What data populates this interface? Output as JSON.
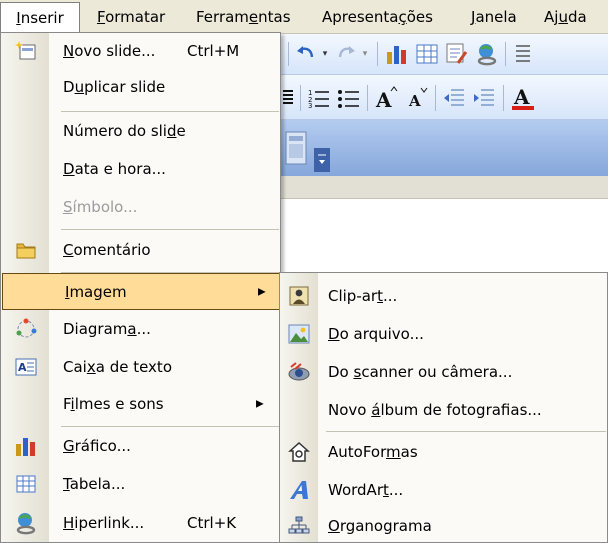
{
  "menubar": {
    "items": [
      {
        "label": "Inserir",
        "mnemonic_index": 0,
        "active": true
      },
      {
        "label": "Formatar",
        "mnemonic_index": 0
      },
      {
        "label": "Ferramentas",
        "mnemonic_index": 6
      },
      {
        "label": "Apresentações",
        "mnemonic_index": 9
      },
      {
        "label": "Janela",
        "mnemonic_index": 0
      },
      {
        "label": "Ajuda",
        "mnemonic_index": 2
      }
    ]
  },
  "insert_menu": {
    "items": [
      {
        "label": "Novo slide...",
        "mnemonic_index": 0,
        "shortcut": "Ctrl+M",
        "icon": "new-slide-icon"
      },
      {
        "label": "Duplicar slide",
        "mnemonic_index": 1
      },
      {
        "label": "Número do slide",
        "mnemonic_index": 13
      },
      {
        "label": "Data e hora...",
        "mnemonic_index": 0
      },
      {
        "label": "Símbolo...",
        "mnemonic_index": 0,
        "disabled": true
      },
      {
        "label": "Comentário",
        "mnemonic_index": 0,
        "icon": "comment-icon"
      },
      {
        "label": "Imagem",
        "mnemonic_index": 0,
        "submenu": true,
        "highlighted": true
      },
      {
        "label": "Diagrama...",
        "mnemonic_index": 7,
        "icon": "diagram-icon"
      },
      {
        "label": "Caixa de texto",
        "mnemonic_index": 3,
        "icon": "text-box-icon"
      },
      {
        "label": "Filmes e sons",
        "mnemonic_index": 1,
        "submenu": true
      },
      {
        "label": "Gráfico...",
        "mnemonic_index": 0,
        "icon": "chart-icon"
      },
      {
        "label": "Tabela...",
        "mnemonic_index": 0,
        "icon": "table-icon"
      },
      {
        "label": "Hiperlink...",
        "mnemonic_index": 0,
        "shortcut": "Ctrl+K",
        "icon": "hyperlink-icon"
      }
    ]
  },
  "image_submenu": {
    "items": [
      {
        "label": "Clip-art...",
        "mnemonic_index": 7,
        "icon": "clip-art-icon"
      },
      {
        "label": "Do arquivo...",
        "mnemonic_index": 0,
        "icon": "from-file-icon"
      },
      {
        "label": "Do scanner ou câmera...",
        "mnemonic_index": 3,
        "icon": "scanner-camera-icon"
      },
      {
        "label": "Novo álbum de fotografias...",
        "mnemonic_index": 5
      },
      {
        "label": "AutoFormas",
        "mnemonic_index": 7,
        "icon": "autoshapes-icon"
      },
      {
        "label": "WordArt...",
        "mnemonic_index": 6,
        "icon": "wordart-icon"
      },
      {
        "label": "Organograma",
        "mnemonic_index": 0,
        "icon": "org-chart-icon"
      }
    ]
  },
  "colors": {
    "menubar_bg": "#ece9d8",
    "menu_bg": "#fbfaf7",
    "highlight_bg": "#ffdc97",
    "toolbar_bg": "#d6e5fa"
  }
}
